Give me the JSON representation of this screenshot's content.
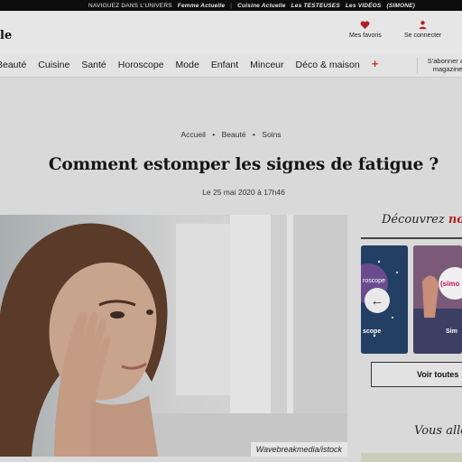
{
  "topbar": {
    "intro": "NAVIGUEZ DANS L'UNIVERS",
    "brand1": "Femme Actuelle",
    "brand2": "Cuisine Actuelle",
    "brand3": "Les TESTEUSES",
    "brand4": "Les VIDÉOS",
    "brand5": "(SIMONE)"
  },
  "header": {
    "logo": "le",
    "favorites_label": "Mes favoris",
    "login_label": "Se connecter"
  },
  "nav": {
    "items": [
      "Beauté",
      "Cuisine",
      "Santé",
      "Horoscope",
      "Mode",
      "Enfant",
      "Minceur",
      "Déco & maison"
    ],
    "more_symbol": "+",
    "subscribe_label": "S'abonner au magazine"
  },
  "article": {
    "breadcrumb": [
      "Accueil",
      "Beauté",
      "Soins"
    ],
    "title": "Comment estomper les signes de fatigue ?",
    "date": "Le 25 mai 2020 à 17h46",
    "photo_credit": "Wavebreakmedia/istock"
  },
  "sidebar": {
    "discover_prefix": "Découvrez ",
    "discover_accent": "nos",
    "card1_label": "roscope",
    "card1_caption": "scope",
    "card2_label": "(simo",
    "card2_caption": "Sim",
    "prev_arrow": "←",
    "see_all_label": "Voir toutes",
    "you_will_label": "Vous allez"
  },
  "colors": {
    "accent_red": "#b3202a",
    "topbar_bg": "#0d0d0d"
  }
}
